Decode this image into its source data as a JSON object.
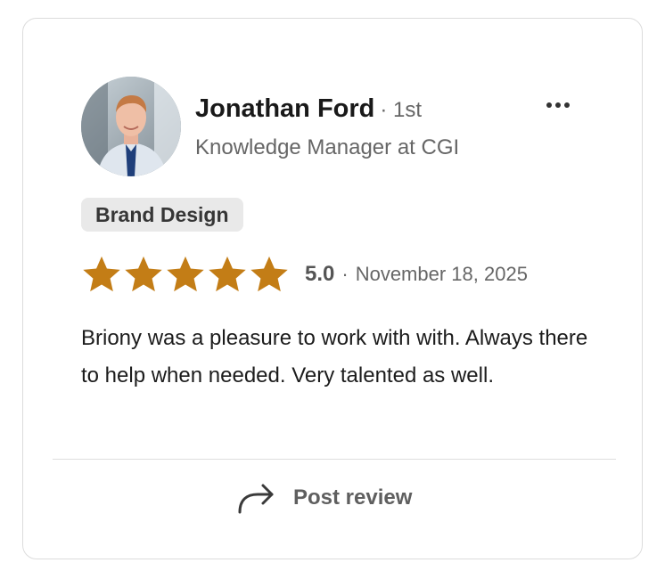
{
  "reviewer": {
    "name": "Jonathan Ford",
    "degree": "· 1st",
    "headline": "Knowledge Manager at CGI",
    "avatar_icon": "profile-photo"
  },
  "menu": {
    "icon": "more-horizontal-icon"
  },
  "tag": {
    "label": "Brand Design"
  },
  "rating": {
    "value": 5,
    "max": 5,
    "score_label": "5.0",
    "separator": "·",
    "date": "November 18, 2025",
    "star_color": "#C37D16"
  },
  "review": {
    "text": "Briony was a pleasure to work with with. Always there to help when needed. Very talented as well."
  },
  "actions": {
    "post_review_label": "Post review",
    "post_review_icon": "share-arrow-icon"
  }
}
